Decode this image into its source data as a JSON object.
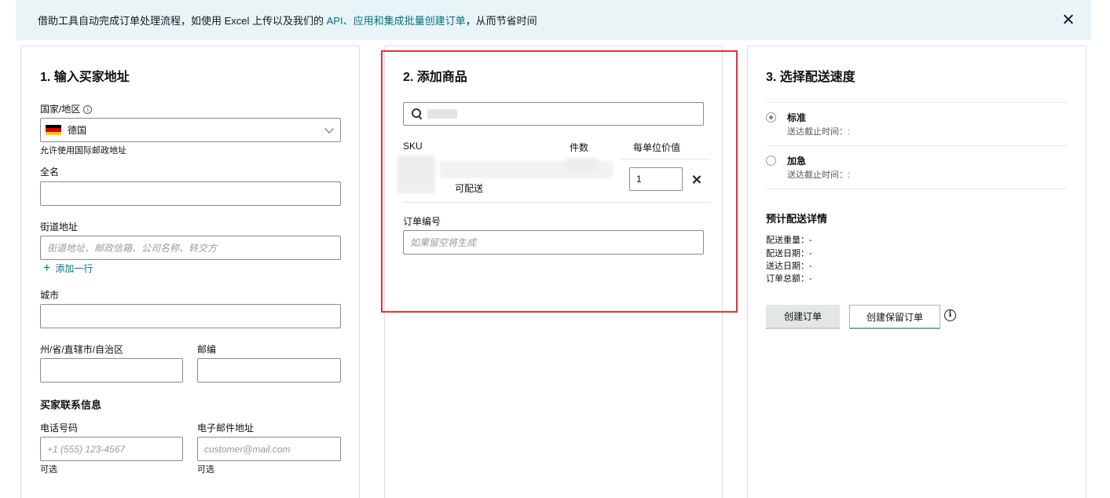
{
  "banner": {
    "text_before": "借助工具自动完成订单处理流程，如使用 Excel 上传以及我们的 ",
    "link_text": "API、应用和集成批量创建订单",
    "text_after": "，从而节省时间"
  },
  "address": {
    "title": "1. 输入买家地址",
    "country_label": "国家/地区",
    "country_value": "德国",
    "country_hint": "允许使用国际邮政地址",
    "full_name_label": "全名",
    "street_label": "街道地址",
    "street_placeholder": "街道地址、邮政信箱、公司名称、转交方",
    "add_line": "添加一行",
    "city_label": "城市",
    "state_label": "州/省/直辖市/自治区",
    "zip_label": "邮编",
    "contact_title": "买家联系信息",
    "phone_label": "电话号码",
    "phone_placeholder": "+1 (555) 123-4567",
    "email_label": "电子邮件地址",
    "email_placeholder": "customer@mail.com",
    "optional": "可选"
  },
  "products": {
    "title": "2. 添加商品",
    "col_sku": "SKU",
    "col_qty": "件数",
    "col_unit_value": "每单位价值",
    "row_status": "可配送",
    "row_qty": "1",
    "order_no_label": "订单编号",
    "order_no_placeholder": "如果留空将生成"
  },
  "shipping": {
    "title": "3. 选择配送速度",
    "standard_label": "标准",
    "standard_sub": "送达截止时间：:",
    "expedited_label": "加急",
    "expedited_sub": "送达截止时间：:",
    "details_title": "预计配送详情",
    "weight": "配送重量：-",
    "ship_date": "配送日期：-",
    "delivery_date": "送达日期：-",
    "total": "订单总额：-",
    "create_order": "创建订单",
    "create_hold_order": "创建保留订单"
  },
  "colors": {
    "link": "#007185",
    "banner_bg": "#e8f4f6",
    "highlight": "#e4343a"
  }
}
